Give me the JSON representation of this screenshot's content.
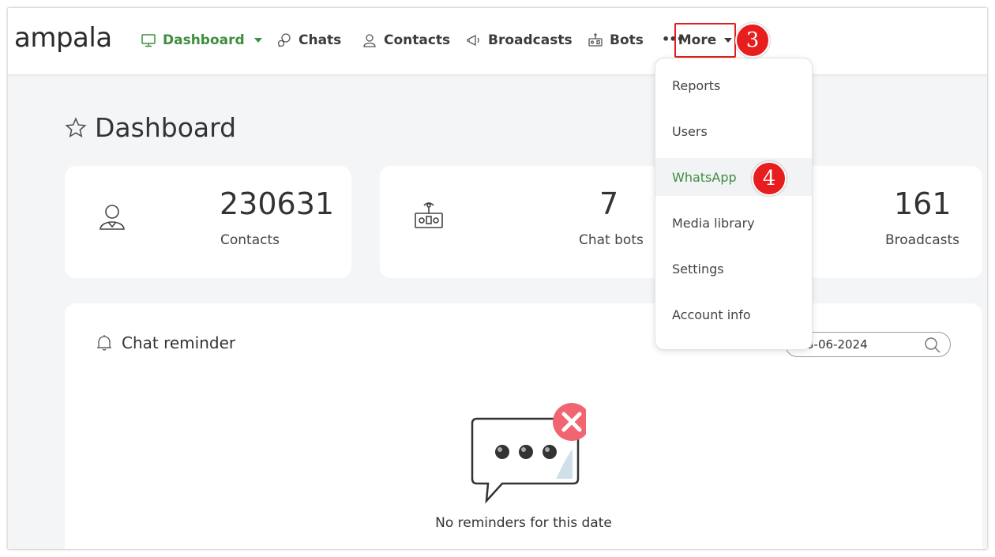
{
  "nav": {
    "logo": "ampala",
    "items": [
      {
        "label": "Dashboard",
        "icon": "monitor-icon"
      },
      {
        "label": "Chats",
        "icon": "chat-bubble-icon"
      },
      {
        "label": "Contacts",
        "icon": "contact-icon"
      },
      {
        "label": "Broadcasts",
        "icon": "megaphone-icon"
      },
      {
        "label": "Bots",
        "icon": "robot-icon"
      }
    ],
    "more_dots": "•••",
    "more_label": "More"
  },
  "annotations": {
    "step_3": "3",
    "step_4": "4",
    "highlight_color": "#e81e1e"
  },
  "page": {
    "title": "Dashboard"
  },
  "stats": [
    {
      "value": "230631",
      "label": "Contacts"
    },
    {
      "value": "7",
      "label": "Chat bots"
    },
    {
      "value": "161",
      "label": "Broadcasts"
    }
  ],
  "reminder": {
    "title": "Chat reminder",
    "date_value": "3-06-2024",
    "empty_text": "No reminders for this date"
  },
  "more_menu": {
    "items": [
      "Reports",
      "Users",
      "WhatsApp",
      "Media library",
      "Settings",
      "Account info"
    ]
  },
  "colors": {
    "accent": "#3e8e3e",
    "text": "#333333",
    "background": "#f4f5f7"
  }
}
